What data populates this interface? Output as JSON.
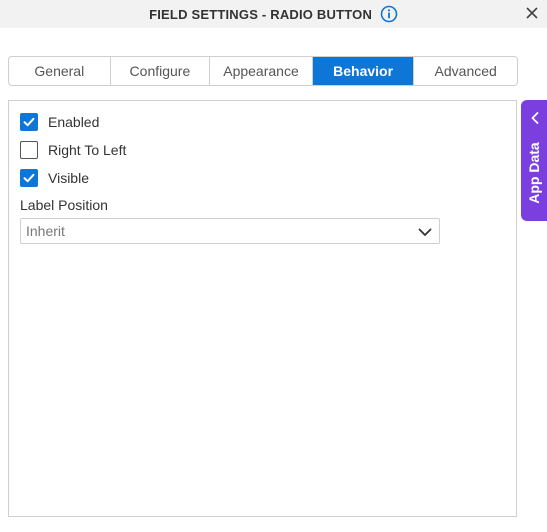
{
  "dialog": {
    "title": "FIELD SETTINGS - RADIO BUTTON",
    "close_icon": "close-icon",
    "info_icon": "info-icon"
  },
  "tabs": [
    {
      "label": "General",
      "active": false
    },
    {
      "label": "Configure",
      "active": false
    },
    {
      "label": "Appearance",
      "active": false
    },
    {
      "label": "Behavior",
      "active": true
    },
    {
      "label": "Advanced",
      "active": false
    }
  ],
  "behavior": {
    "enabled": {
      "label": "Enabled",
      "checked": true
    },
    "right_to_left": {
      "label": "Right To Left",
      "checked": false
    },
    "visible": {
      "label": "Visible",
      "checked": true
    },
    "label_position": {
      "label": "Label Position",
      "value": "Inherit"
    }
  },
  "side_panel": {
    "label": "App Data",
    "icon": "chevron-left-icon"
  },
  "colors": {
    "accent": "#0e76d6",
    "side_tab": "#7b3fe0"
  }
}
